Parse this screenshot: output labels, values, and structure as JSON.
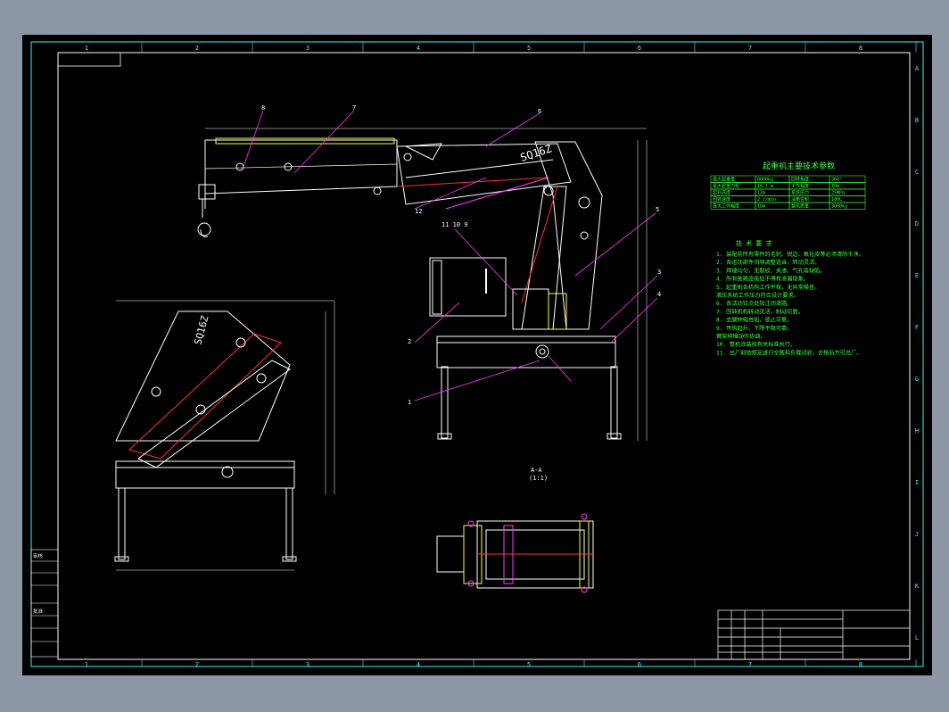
{
  "drawing": {
    "background": "#000000",
    "frame_color": "#3df1ff",
    "line_color": "#ffffff",
    "text_green": "#36ff3a",
    "accent_magenta": "#ff38ff",
    "accent_yellow": "#ffff40",
    "accent_red": "#ff3030",
    "zones_top": [
      "1",
      "2",
      "3",
      "4",
      "5",
      "6",
      "7",
      "8"
    ],
    "zones_bottom": [
      "1",
      "2",
      "3",
      "4",
      "5",
      "6",
      "7",
      "8"
    ],
    "zones_right": [
      "A",
      "B",
      "C",
      "D",
      "E",
      "F",
      "G",
      "H",
      "I",
      "J",
      "K",
      "L"
    ],
    "title_param": "起重机主要技术参数",
    "section_title": "A-A",
    "section_sub": "(1:1)",
    "model_mark": "SQ16Z",
    "tech_req_title": "技 术 要 求",
    "tech_req_lines": [
      "1. 装配前所有零件的毛刺、锐边、氧化皮等必须清除干净。",
      "2. 各运动部件间隙调整适当，转动灵活。",
      "3. 焊缝均匀，无裂纹、夹渣、气孔等缺陷。",
      "4. 所有管路连接处不得有渗漏现象。",
      "5. 起重机各机构工作平稳，无异常噪音。",
      "   液压系统工作压力符合设计要求。",
      "6. 各活动铰点处加注润滑脂。",
      "7. 回转机构转动灵活，制动可靠。",
      "8. 支腿伸缩自如，锁止可靠。",
      "9. 吊钩起升、下降平稳可靠。",
      "   臂架伸缩动作协调。",
      "10. 整机涂装按有关标准执行。",
      "11. 出厂前按规定进行空载和负载试验，合格后方可出厂。"
    ],
    "param_rows": [
      [
        "最大起重量",
        "8000kg",
        "回转角度",
        "360°"
      ],
      [
        "最大起重力矩",
        "16 t.m",
        "工作幅度",
        "10m"
      ],
      [
        "起升高度",
        "12m",
        "系统压力",
        "25MPa"
      ],
      [
        "回转速度",
        "2 r/min",
        "油箱容积",
        "100L"
      ],
      [
        "最大工作幅度",
        "10m",
        "整机质量",
        "3000kg"
      ]
    ],
    "balloons": [
      "8",
      "7",
      "6",
      "5",
      "4",
      "3",
      "2",
      "1",
      "11 10 9",
      "12"
    ],
    "left_side_labels": [
      "审核",
      "",
      "",
      "批准",
      "",
      ""
    ]
  }
}
